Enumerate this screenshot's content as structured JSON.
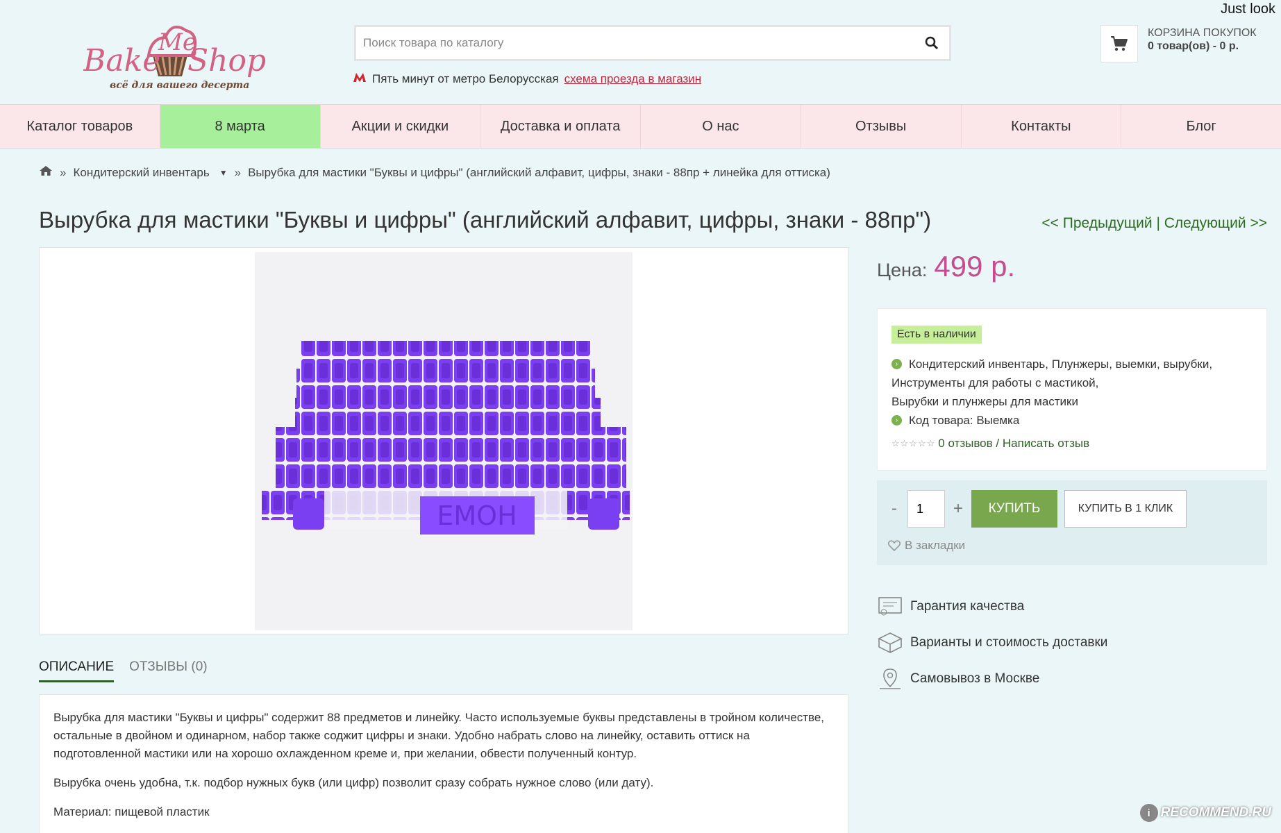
{
  "watermark_top": "Just look",
  "watermark_bottom": "RECOMMEND.RU",
  "logo": {
    "line1": "Me",
    "line2": "Bake",
    "line3": "Shop",
    "tagline": "всё для вашего десерта"
  },
  "search": {
    "placeholder": "Поиск товара по каталогу"
  },
  "metro": {
    "text": "Пять минут от метро Белорусская",
    "link": "схема проезда в магазин"
  },
  "cart": {
    "title": "КОРЗИНА ПОКУПОК",
    "count": "0 товар(ов) - 0 р."
  },
  "nav": {
    "items": [
      {
        "label": "Каталог товаров"
      },
      {
        "label": "8 марта"
      },
      {
        "label": "Акции и скидки"
      },
      {
        "label": "Доставка и оплата"
      },
      {
        "label": "О нас"
      },
      {
        "label": "Отзывы"
      },
      {
        "label": "Контакты"
      },
      {
        "label": "Блог"
      }
    ]
  },
  "breadcrumb": {
    "category": "Кондитерский инвентарь",
    "current": "Вырубка для мастики \"Буквы и цифры\" (английский алфавит, цифры, знаки - 88пр + линейка для оттиска)"
  },
  "product": {
    "title": "Вырубка для мастики \"Буквы и цифры\" (английский алфавит, цифры, знаки - 88пр\")",
    "prev": "<< Предыдущий",
    "divider": "|",
    "next": "Следующий >>",
    "price_label": "Цена:",
    "price_value": "499 р.",
    "stock": "Есть в наличии",
    "categories_line1": "Кондитерский инвентарь, Плунжеры, выемки, вырубки,",
    "categories_line2": "Инструменты для работы с мастикой,",
    "categories_line3": "Вырубки и плунжеры для мастики",
    "code": "Код товара: Выемка",
    "reviews_link": "0 отзывов / Написать отзыв",
    "stamp_text": "EMOH"
  },
  "buy": {
    "minus": "-",
    "qty": "1",
    "plus": "+",
    "buy_label": "КУПИТЬ",
    "oneclick_label": "КУПИТЬ В 1 КЛИК",
    "bookmark": "В закладки"
  },
  "features": [
    {
      "label": "Гарантия качества"
    },
    {
      "label": "Варианты и стоимость доставки"
    },
    {
      "label": "Самовывоз в Москве"
    }
  ],
  "tabs": [
    {
      "label": "ОПИСАНИЕ"
    },
    {
      "label": "ОТЗЫВЫ (0)"
    }
  ],
  "description": {
    "p1": "Вырубка для мастики \"Буквы и цифры\" содержит 88 предметов и линейку. Часто используемые буквы представлены в тройном количестве, остальные в двойном и одинарном, набор также соджит цифры и знаки. Удобно набрать слово на линейку, оставить оттиск на подготовленной мастики или на хорошо охлажденном креме и, при желании, обвести полученный контур.",
    "p2": "Вырубка очень удобна, т.к. подбор нужных букв (или цифр) позволит сразу собрать нужное слово (или дату).",
    "p3": "Материал: пищевой пластик"
  },
  "colors": {
    "page_bg": "#eaf6f8",
    "nav_bg": "#fbe6ea",
    "nav_active": "#a8ef9b",
    "price": "#c74b8f",
    "buy_button": "#79a74d",
    "link_green": "#2c5f24",
    "product_purple": "#7b3ff2"
  }
}
